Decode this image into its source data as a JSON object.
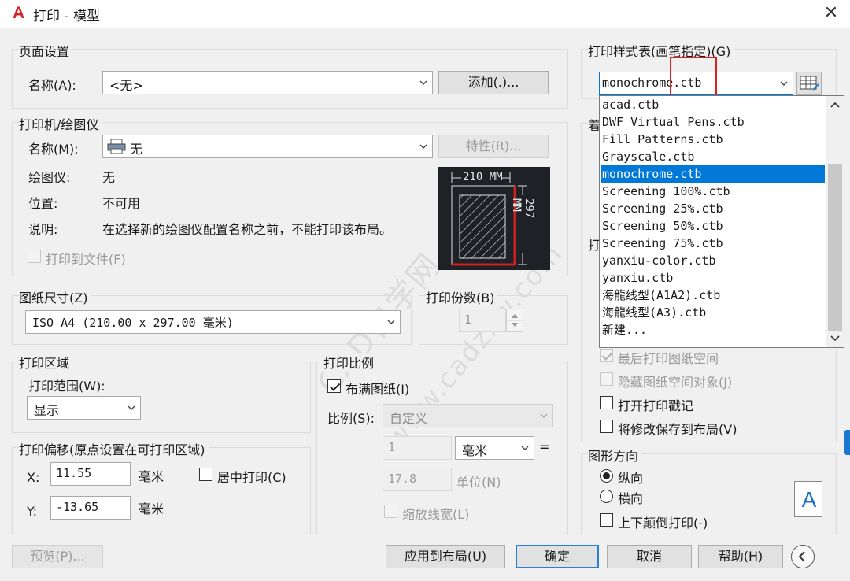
{
  "window": {
    "title": "打印 - 模型",
    "app_icon_letter": "A",
    "close_glyph": "✕"
  },
  "page_setup": {
    "legend": "页面设置",
    "name_label": "名称(A):",
    "name_value": "<无>",
    "add_button": "添加(.)..."
  },
  "plotter": {
    "legend": "打印机/绘图仪",
    "name_label": "名称(M):",
    "name_value": "无",
    "properties_button": "特性(R)...",
    "plotter_label": "绘图仪:",
    "plotter_value": "无",
    "location_label": "位置:",
    "location_value": "不可用",
    "description_label": "说明:",
    "description_value": "在选择新的绘图仪配置名称之前，不能打印该布局。",
    "print_to_file": "打印到文件(F)",
    "preview_width": "210 MM",
    "preview_height": "297 MM"
  },
  "paper_size": {
    "legend": "图纸尺寸(Z)",
    "value": "ISO A4 (210.00 x 297.00 毫米)"
  },
  "copies": {
    "legend": "打印份数(B)",
    "value": "1"
  },
  "plot_area": {
    "legend": "打印区域",
    "range_label": "打印范围(W):",
    "range_value": "显示"
  },
  "plot_offset": {
    "legend": "打印偏移(原点设置在可打印区域)",
    "x_label": "X:",
    "x_value": "11.55",
    "x_unit": "毫米",
    "y_label": "Y:",
    "y_value": "-13.65",
    "y_unit": "毫米",
    "center_label": "居中打印(C)"
  },
  "plot_scale": {
    "legend": "打印比例",
    "fit_label": "布满图纸(I)",
    "scale_label": "比例(S):",
    "scale_value": "自定义",
    "value1": "1",
    "unit_value": "毫米",
    "equals": "=",
    "value2": "17.8",
    "unit_label": "单位(N)",
    "lineweights_label": "缩放线宽(L)"
  },
  "plot_style": {
    "legend": "打印样式表(画笔指定)(G)",
    "selected": "monochrome.ctb",
    "items": [
      "acad.ctb",
      "DWF Virtual Pens.ctb",
      "Fill Patterns.ctb",
      "Grayscale.ctb",
      "monochrome.ctb",
      "Screening 100%.ctb",
      "Screening 25%.ctb",
      "Screening 50%.ctb",
      "Screening 75%.ctb",
      "yanxiu-color.ctb",
      "yanxiu.ctb",
      "海龍线型(A1A2).ctb",
      "海龍线型(A3).ctb",
      "新建..."
    ],
    "partial_label_1": "着",
    "partial_label_2": "打"
  },
  "options": {
    "last_paperspace": "最后打印图纸空间",
    "hide_objects": "隐藏图纸空间对象(J)",
    "stamp": "打开打印戳记",
    "save_changes": "将修改保存到布局(V)"
  },
  "orientation": {
    "legend": "图形方向",
    "portrait": "纵向",
    "landscape": "横向",
    "upside_down": "上下颠倒打印(-)",
    "icon_letter": "A"
  },
  "footer": {
    "preview": "预览(P)...",
    "apply": "应用到布局(U)",
    "ok": "确定",
    "cancel": "取消",
    "help": "帮助(H)"
  },
  "watermark": {
    "line1": "CAD自学网",
    "line2": "www.cadzxw.com"
  }
}
